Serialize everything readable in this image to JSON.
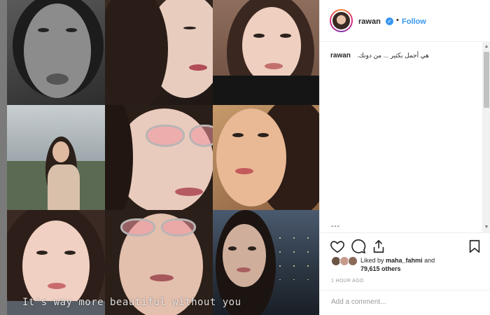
{
  "post": {
    "overlay_caption": "It's way more beautiful without you"
  },
  "header": {
    "username": "rawan",
    "verified_icon": "verified-badge-icon",
    "separator": "•",
    "follow_label": "Follow"
  },
  "caption": {
    "username": "rawan",
    "text": ".هي أجمل بكثير ... من دونك"
  },
  "comments_divider": "---",
  "actions": {
    "icons": [
      "heart-icon",
      "comment-icon",
      "share-icon",
      "bookmark-icon"
    ]
  },
  "likes": {
    "prefix": "Liked by ",
    "user": "maha_fahmi",
    "middle": " and",
    "count": "79,615 others"
  },
  "timestamp": "1 HOUR AGO",
  "comment_input": {
    "placeholder": "Add a comment..."
  },
  "colors": {
    "accent": "#3897f0",
    "text": "#262626",
    "muted": "#999999"
  }
}
